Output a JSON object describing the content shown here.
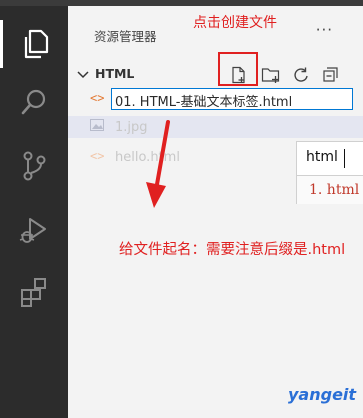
{
  "explorer": {
    "title": "资源管理器",
    "more": "···",
    "folder_name": "HTML",
    "rename_value": "01. HTML-基础文本标签.html",
    "files": [
      {
        "icon": "image-icon",
        "name": "1.jpg"
      },
      {
        "icon": "code-icon",
        "name": "hello.html"
      }
    ]
  },
  "toolbar": {
    "new_file": "new-file-icon",
    "new_folder": "new-folder-icon",
    "refresh": "refresh-icon",
    "collapse": "collapse-all-icon"
  },
  "activity_bar": [
    "explorer-icon",
    "search-icon",
    "source-control-icon",
    "run-debug-icon",
    "extensions-icon"
  ],
  "annotations": {
    "top": "点击创建文件",
    "bottom": "给文件起名：需要注意后缀是.html"
  },
  "zoom_popup": {
    "input_text": "html",
    "suggestion": "1. html"
  },
  "watermark": "yangeit",
  "colors": {
    "accent": "#0078d4",
    "annotation": "#e02020",
    "activity_bg": "#2c2c2c",
    "sidebar_bg": "#f3f3f3"
  }
}
